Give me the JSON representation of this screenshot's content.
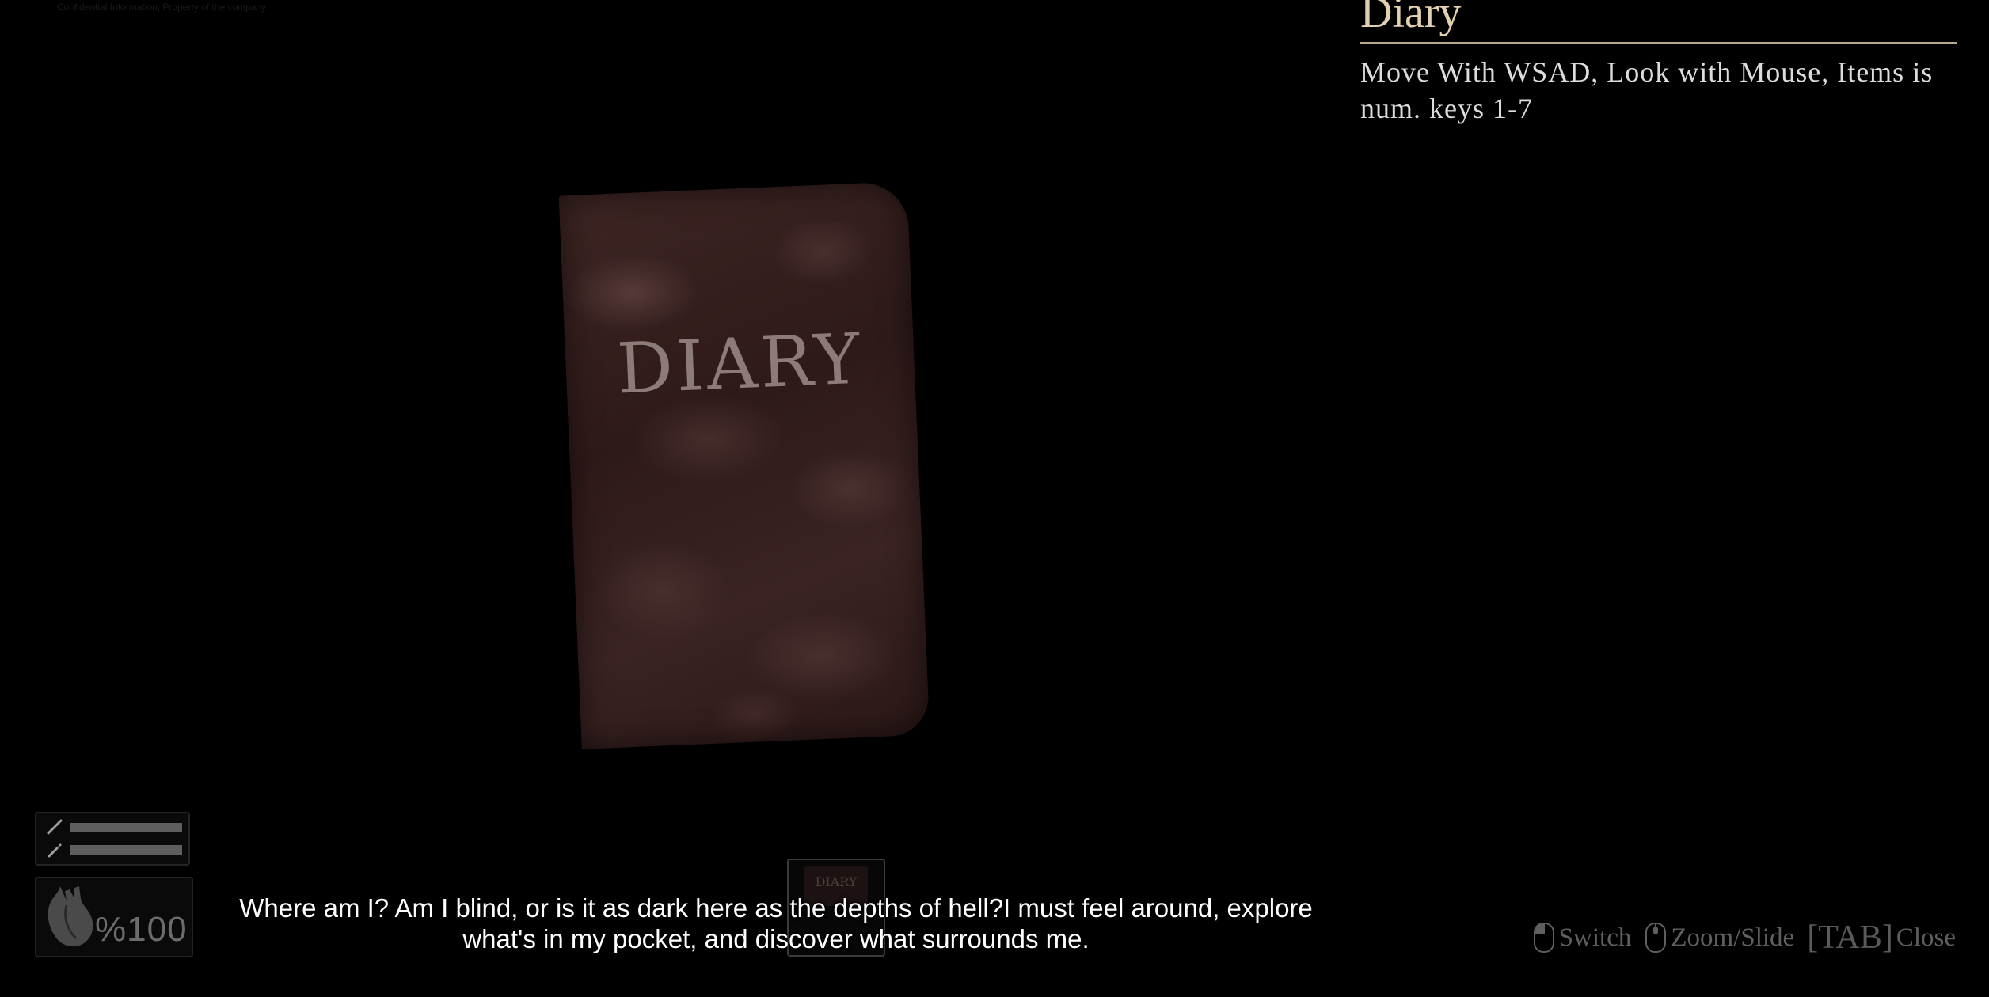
{
  "corner_note": "Confidential Information, Property of the company",
  "viewer": {
    "book_cover_text": "DIARY"
  },
  "item_panel": {
    "title": "Diary",
    "description": "Move With WSAD, Look with Mouse, Items is num. keys 1-7"
  },
  "hud": {
    "tools": [
      {
        "icon": "pencil-icon",
        "level": 1.0
      },
      {
        "icon": "lighter-icon",
        "level": 1.0
      }
    ],
    "health_icon": "heart-icon",
    "health_value": "%100"
  },
  "inventory": {
    "slots": [
      {
        "item": "Diary",
        "thumb_label": "DIARY"
      }
    ]
  },
  "subtitle": {
    "text": "Where am I? Am I blind, or is it as dark here as the depths of hell?I must feel around, explore what's in my pocket, and discover what surrounds me."
  },
  "controls": {
    "switch_label": "Switch",
    "zoom_label": "Zoom/Slide",
    "tab_key": "[TAB]",
    "close_label": "Close"
  },
  "colors": {
    "title": "#e3d0b0",
    "description": "#dcdcdc",
    "subtitle": "#ffffff",
    "hint": "#5f5f5f",
    "background": "#000000"
  }
}
